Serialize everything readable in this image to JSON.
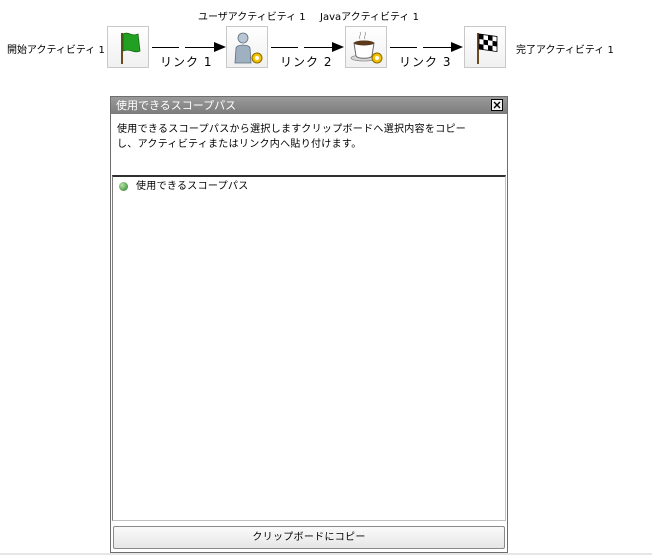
{
  "workflow": {
    "activities": [
      {
        "label": "開始アクティビティ 1",
        "icon": "start-flag-icon"
      },
      {
        "label": "ユーザアクティビティ 1",
        "icon": "user-activity-icon"
      },
      {
        "label": "Javaアクティビティ 1",
        "icon": "java-activity-icon"
      },
      {
        "label": "完了アクティビティ 1",
        "icon": "finish-flag-icon"
      }
    ],
    "links": [
      {
        "label": "リンク 1"
      },
      {
        "label": "リンク 2"
      },
      {
        "label": "リンク 3"
      }
    ]
  },
  "dialog": {
    "title": "使用できるスコープパス",
    "instruction_line1": "使用できるスコープパスから選択しますクリップボードへ選択内容をコピー",
    "instruction_line2": "し、アクティビティまたはリンク内へ貼り付けます。",
    "tree": {
      "items": [
        {
          "label": "使用できるスコープパス",
          "icon": "green-dot-icon"
        }
      ]
    },
    "copy_button_label": "クリップボードにコピー",
    "close_icon": "close-icon"
  },
  "colors": {
    "titlebar": "#8a8a8a",
    "start_flag": "#22a022",
    "node_border": "#c8c8c8"
  }
}
